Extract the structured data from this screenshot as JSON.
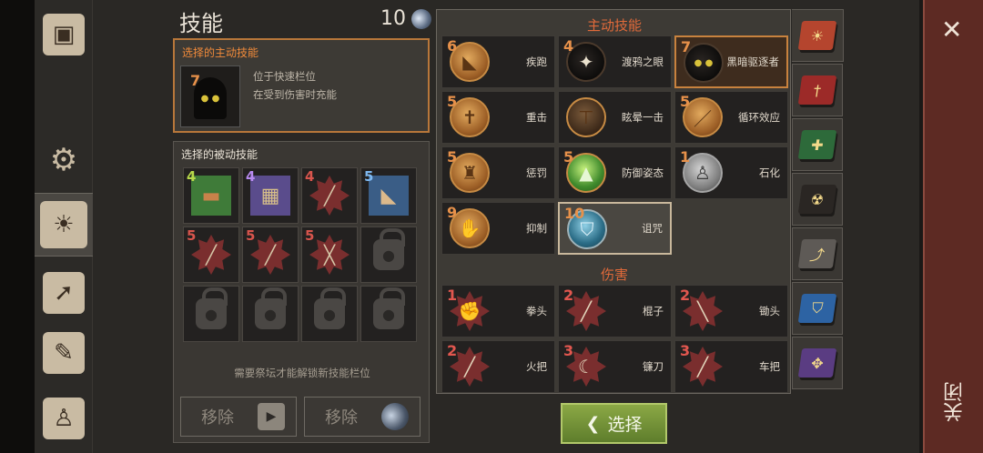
{
  "header": {
    "title": "技能",
    "points": "10",
    "points_icon": "gem-icon"
  },
  "active_slot": {
    "heading": "选择的主动技能",
    "level": "7",
    "desc_line1": "位于快速栏位",
    "desc_line2": "在受到伤害时充能"
  },
  "passive": {
    "heading": "选择的被动技能",
    "slots": [
      {
        "level": "4",
        "icon": "bandage-icon"
      },
      {
        "level": "4",
        "icon": "map-icon"
      },
      {
        "level": "4",
        "icon": "mace-icon"
      },
      {
        "level": "5",
        "icon": "boot-icon"
      },
      {
        "level": "5",
        "icon": "sword-icon"
      },
      {
        "level": "5",
        "icon": "spear-icon"
      },
      {
        "level": "5",
        "icon": "axe-icon"
      }
    ],
    "unlock_hint": "需要祭坛才能解锁新技能栏位",
    "remove_label_1": "移除",
    "remove_label_2": "移除"
  },
  "active_section": {
    "heading": "主动技能",
    "skills": [
      {
        "level": "6",
        "name": "疾跑"
      },
      {
        "level": "4",
        "name": "渡鸦之眼"
      },
      {
        "level": "7",
        "name": "黑暗驱逐者"
      },
      {
        "level": "5",
        "name": "重击"
      },
      {
        "level": "",
        "name": "眩晕一击"
      },
      {
        "level": "5",
        "name": "循环效应"
      },
      {
        "level": "5",
        "name": "惩罚"
      },
      {
        "level": "5",
        "name": "防御姿态"
      },
      {
        "level": "1",
        "name": "石化"
      },
      {
        "level": "9",
        "name": "抑制"
      },
      {
        "level": "10",
        "name": "诅咒"
      }
    ]
  },
  "damage_section": {
    "heading": "伤害",
    "skills": [
      {
        "level": "1",
        "name": "拳头"
      },
      {
        "level": "2",
        "name": "棍子"
      },
      {
        "level": "2",
        "name": "锄头"
      },
      {
        "level": "2",
        "name": "火把"
      },
      {
        "level": "3",
        "name": "镰刀"
      },
      {
        "level": "3",
        "name": "车把"
      }
    ]
  },
  "select_button": {
    "label": "选择"
  },
  "close_label": "关闭",
  "colors": {
    "accent": "#e06a3a",
    "select_green": "#7a9a3a",
    "close_red": "#5d2a23"
  }
}
